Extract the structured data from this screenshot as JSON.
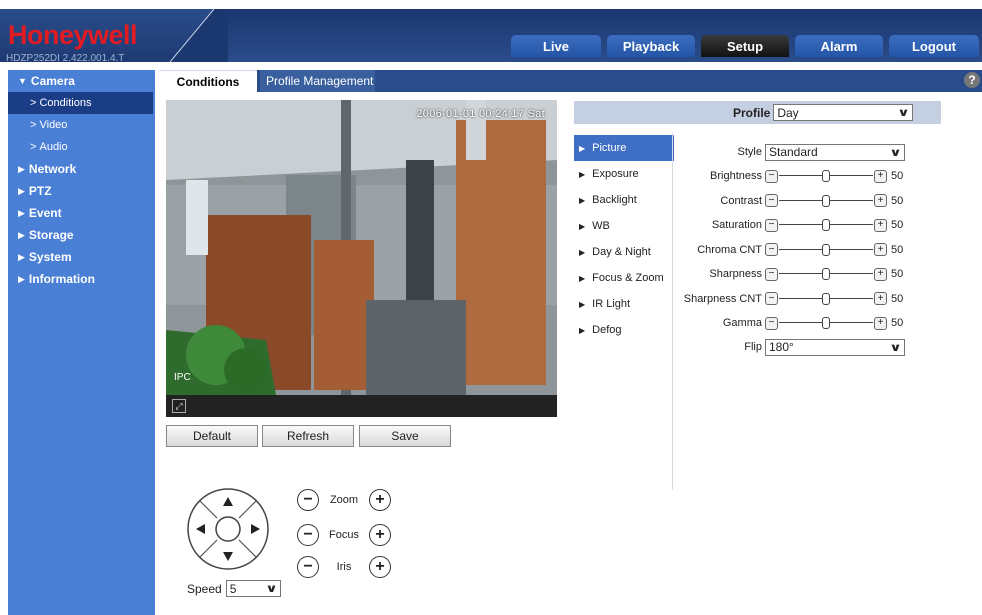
{
  "header": {
    "logo": "Honeywell",
    "firmware": "HDZP252DI 2.422.001.4.T",
    "tabs": [
      {
        "label": "Live",
        "active": false
      },
      {
        "label": "Playback",
        "active": false
      },
      {
        "label": "Setup",
        "active": true
      },
      {
        "label": "Alarm",
        "active": false
      },
      {
        "label": "Logout",
        "active": false
      }
    ]
  },
  "sidebar": {
    "camera": "Camera",
    "sub": [
      "Conditions",
      "Video",
      "Audio"
    ],
    "sections": [
      "Network",
      "PTZ",
      "Event",
      "Storage",
      "System",
      "Information"
    ]
  },
  "content_tabs": {
    "conditions": "Conditions",
    "profile_management": "Profile Management"
  },
  "help": "?",
  "video": {
    "osd_time": "2006-01-01 00:24:17 Sat",
    "osd_cam": "IPC"
  },
  "buttons": {
    "default": "Default",
    "refresh": "Refresh",
    "save": "Save"
  },
  "ptz": {
    "zoom": "Zoom",
    "focus": "Focus",
    "iris": "Iris",
    "minus": "−",
    "plus": "+",
    "speed_label": "Speed",
    "speed_value": "5"
  },
  "profile": {
    "label": "Profile",
    "value": "Day"
  },
  "menu": [
    "Picture",
    "Exposure",
    "Backlight",
    "WB",
    "Day & Night",
    "Focus & Zoom",
    "IR Light",
    "Defog"
  ],
  "picture": {
    "style_label": "Style",
    "style_value": "Standard",
    "sliders": [
      {
        "label": "Brightness",
        "value": 50
      },
      {
        "label": "Contrast",
        "value": 50
      },
      {
        "label": "Saturation",
        "value": 50
      },
      {
        "label": "Chroma CNT",
        "value": 50
      },
      {
        "label": "Sharpness",
        "value": 50
      },
      {
        "label": "Sharpness CNT",
        "value": 50
      },
      {
        "label": "Gamma",
        "value": 50
      }
    ],
    "flip_label": "Flip",
    "flip_value": "180°"
  },
  "colors": {
    "nav_dark": "#1e3a73",
    "sidebar": "#4a7fd6",
    "active_menu": "#3f6fc4",
    "brand_red": "#e11b22"
  },
  "icons": [
    "fullscreen-icon",
    "pan-up-icon",
    "pan-down-icon",
    "pan-left-icon",
    "pan-right-icon",
    "help-icon"
  ]
}
